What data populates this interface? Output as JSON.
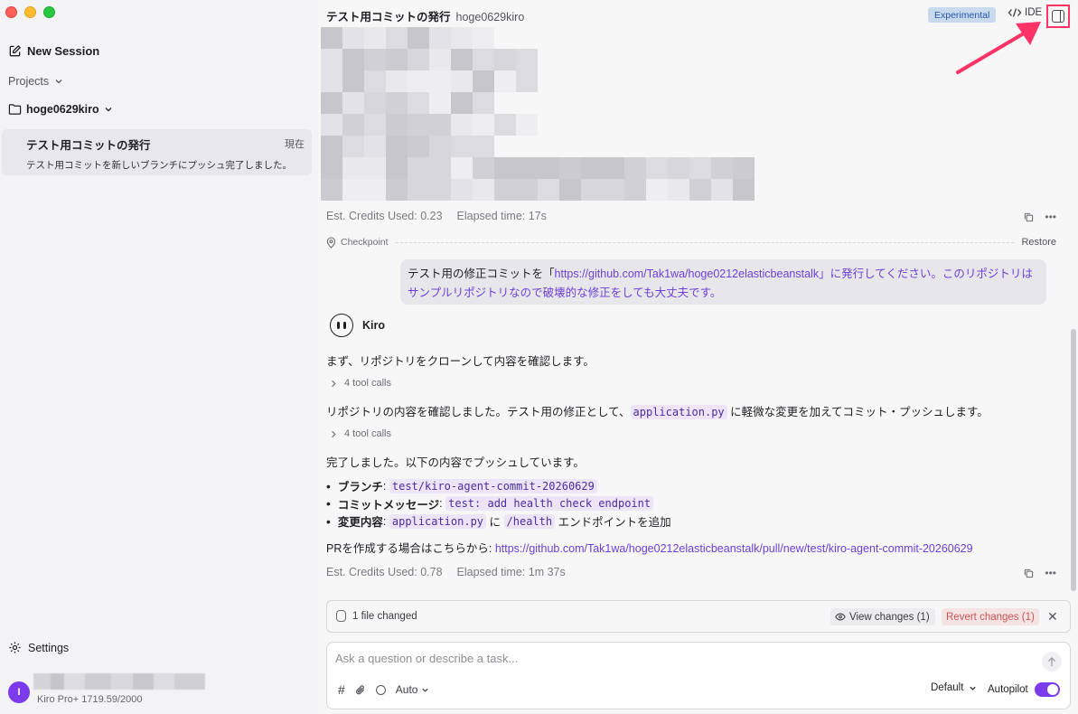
{
  "sidebar": {
    "new_session_label": "New Session",
    "projects_label": "Projects",
    "project_name": "hoge0629kiro",
    "session": {
      "title": "テスト用コミットの発行",
      "time": "現在",
      "summary": "テスト用コミットを新しいブランチにプッシュ完了しました。"
    },
    "settings_label": "Settings",
    "user_initial": "I",
    "plan_text": "Kiro Pro+ 1719.59/2000"
  },
  "header": {
    "title": "テスト用コミットの発行",
    "project": "hoge0629kiro",
    "experimental_badge": "Experimental",
    "ide_label": "IDE"
  },
  "previous_turn": {
    "credits": "Est. Credits Used: 0.23",
    "elapsed": "Elapsed time: 17s"
  },
  "checkpoint": {
    "label": "Checkpoint",
    "restore_label": "Restore"
  },
  "user_message": {
    "prefix": "テスト用の修正コミットを「",
    "link": "https://github.com/Tak1wa/hoge0212elasticbeanstalk",
    "suffix1": "」に発行してください。このリポジトリは",
    "line2": "サンプルリポジトリなので破壊的な修正をしても大丈夫です。"
  },
  "agent": {
    "name": "Kiro",
    "p1": "まず、リポジトリをクローンして内容を確認します。",
    "tool_calls_1": "4 tool calls",
    "p2_before": "リポジトリの内容を確認しました。テスト用の修正として、",
    "p2_code": "application.py",
    "p2_after": "に軽微な変更を加えてコミット・プッシュします。",
    "tool_calls_2": "4 tool calls",
    "p3": "完了しました。以下の内容でプッシュしています。",
    "bullets": [
      {
        "label": "ブランチ",
        "code": "test/kiro-agent-commit-20260629"
      },
      {
        "label": "コミットメッセージ",
        "code": "test: add health check endpoint"
      },
      {
        "label": "変更内容",
        "code": "application.py",
        "mid": "に",
        "code2": "/health",
        "tail": "エンドポイントを追加"
      }
    ],
    "pr_prefix": "PRを作成する場合はこちらから: ",
    "pr_link": "https://github.com/Tak1wa/hoge0212elasticbeanstalk/pull/new/test/kiro-agent-commit-20260629",
    "credits": "Est. Credits Used: 0.78",
    "elapsed": "Elapsed time: 1m 37s"
  },
  "changes_bar": {
    "text": "1 file changed",
    "view_label": "View changes (1)",
    "revert_label": "Revert changes (1)"
  },
  "composer": {
    "placeholder": "Ask a question or describe a task...",
    "mode_label": "Auto",
    "model_label": "Default",
    "autopilot_label": "Autopilot",
    "autopilot_on": true
  },
  "colors": {
    "accent": "#7c3aed",
    "link": "#6d3fd6",
    "highlight": "#ff3366"
  }
}
